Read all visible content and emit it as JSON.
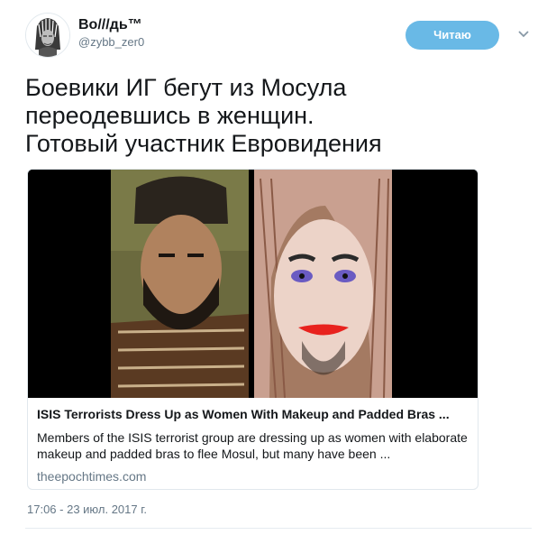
{
  "header": {
    "display_name": "Во///дь™",
    "username": "@zybb_zer0",
    "follow_label": "Читаю"
  },
  "tweet": {
    "lines": [
      "Боевики ИГ бегут из Мосула",
      "переодевшись в женщин.",
      "Готовый участник Евровидения"
    ],
    "timestamp": "17:06 - 23 июл. 2017 г."
  },
  "card": {
    "title": "ISIS Terrorists Dress Up as Women With Makeup and Padded Bras ...",
    "description": "Members of the ISIS terrorist group are dressing up as women with elaborate makeup and padded bras to flee Mosul, but many have been ...",
    "domain": "theepochtimes.com"
  },
  "colors": {
    "accent": "#69b9e6",
    "text": "#14171a",
    "secondary": "#657786",
    "border": "#e1e8ed"
  },
  "icons": {
    "avatar": "avatar-icon",
    "caret": "chevron-down-icon"
  }
}
